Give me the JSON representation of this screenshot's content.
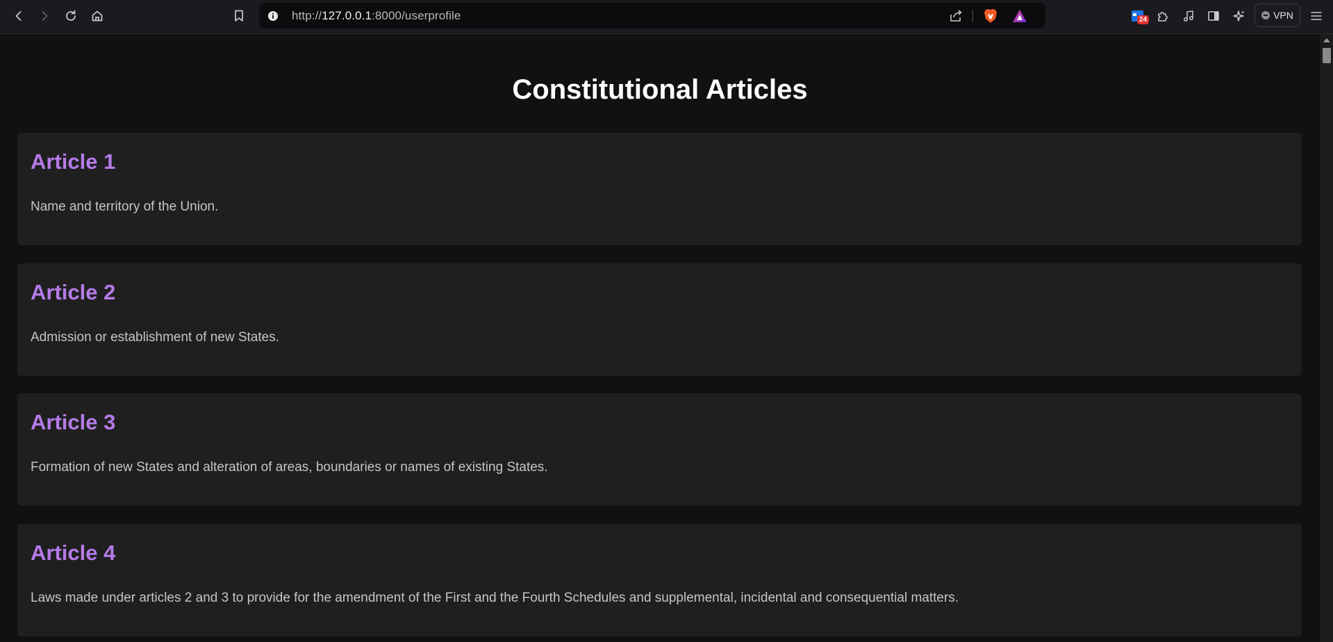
{
  "browser": {
    "url_scheme": "http://",
    "url_host": "127.0.0.1",
    "url_path": ":8000/userprofile",
    "extension_badge": "24",
    "vpn_label": "VPN",
    "icons": {
      "back": "back-arrow-icon",
      "forward": "forward-arrow-icon",
      "reload": "reload-icon",
      "home": "home-icon",
      "bookmark": "bookmark-icon",
      "site_info": "info-icon",
      "share": "share-icon",
      "brave_shields": "brave-lion-icon",
      "rewards": "rewards-triangle-icon",
      "extension": "calendar-extension-icon",
      "extensions": "puzzle-icon",
      "media": "music-note-icon",
      "sidebar": "sidebar-icon",
      "leo": "sparkle-icon",
      "menu": "hamburger-menu-icon"
    }
  },
  "page": {
    "title": "Constitutional Articles",
    "articles": [
      {
        "title": "Article 1",
        "description": "Name and territory of the Union."
      },
      {
        "title": "Article 2",
        "description": "Admission or establishment of new States."
      },
      {
        "title": "Article 3",
        "description": "Formation of new States and alteration of areas, boundaries or names of existing States."
      },
      {
        "title": "Article 4",
        "description": "Laws made under articles 2 and 3 to provide for the amendment of the First and the Fourth Schedules and supplemental, incidental and consequential matters."
      }
    ]
  },
  "colors": {
    "background": "#111111",
    "card": "#1f1f1f",
    "accent": "#b57be8",
    "text": "#c6c6c6",
    "title": "#ffffff"
  }
}
